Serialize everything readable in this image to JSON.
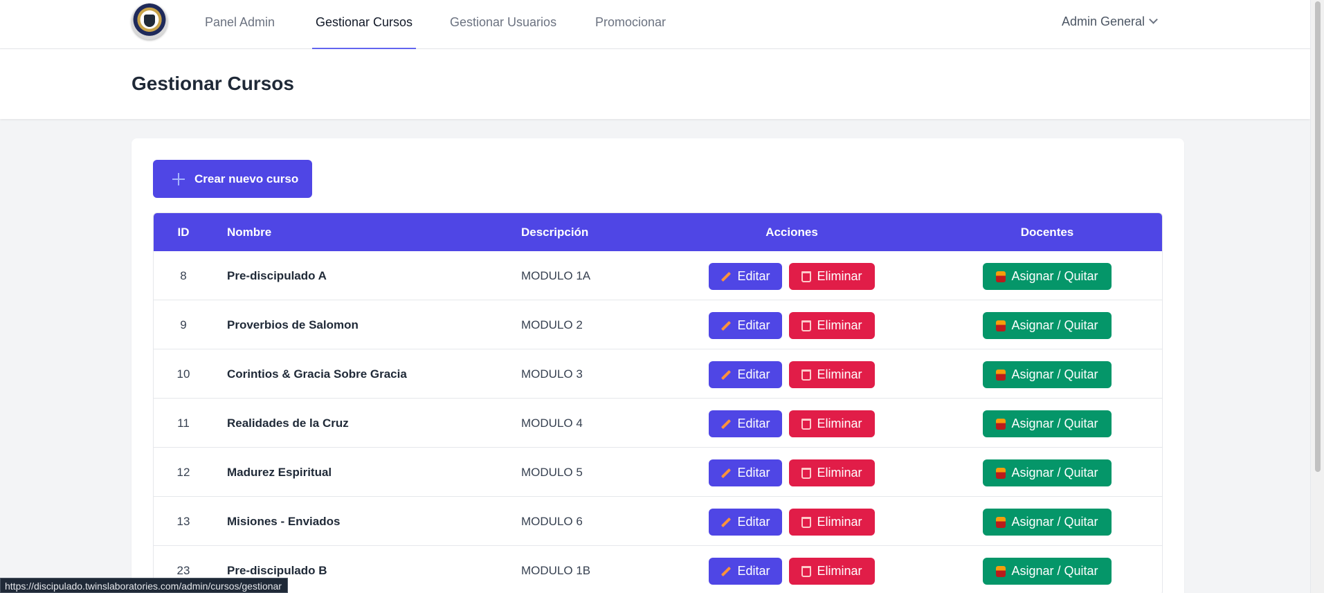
{
  "nav": {
    "links": [
      {
        "label": "Panel Admin",
        "active": false
      },
      {
        "label": "Gestionar Cursos",
        "active": true
      },
      {
        "label": "Gestionar Usuarios",
        "active": false
      },
      {
        "label": "Promocionar",
        "active": false
      }
    ],
    "user_label": "Admin General"
  },
  "header": {
    "title": "Gestionar Cursos"
  },
  "main": {
    "create_button_label": "Crear nuevo curso",
    "table": {
      "columns": [
        "ID",
        "Nombre",
        "Descripción",
        "Acciones",
        "Docentes"
      ],
      "rows": [
        {
          "id": "8",
          "name": "Pre-discipulado A",
          "description": "MODULO 1A"
        },
        {
          "id": "9",
          "name": "Proverbios de Salomon",
          "description": "MODULO 2"
        },
        {
          "id": "10",
          "name": "Corintios & Gracia Sobre Gracia",
          "description": "MODULO 3"
        },
        {
          "id": "11",
          "name": "Realidades de la Cruz",
          "description": "MODULO 4"
        },
        {
          "id": "12",
          "name": "Madurez Espiritual",
          "description": "MODULO 5"
        },
        {
          "id": "13",
          "name": "Misiones - Enviados",
          "description": "MODULO 6"
        },
        {
          "id": "23",
          "name": "Pre-discipulado B",
          "description": "MODULO 1B"
        }
      ],
      "edit_label": "Editar",
      "delete_label": "Eliminar",
      "assign_label": "Asignar / Quitar"
    }
  },
  "status_bar": {
    "url": "https://discipulado.twinslaboratories.com/admin/cursos/gestionar"
  },
  "colors": {
    "primary": "#4f46e5",
    "danger": "#e11d48",
    "success": "#059669"
  }
}
